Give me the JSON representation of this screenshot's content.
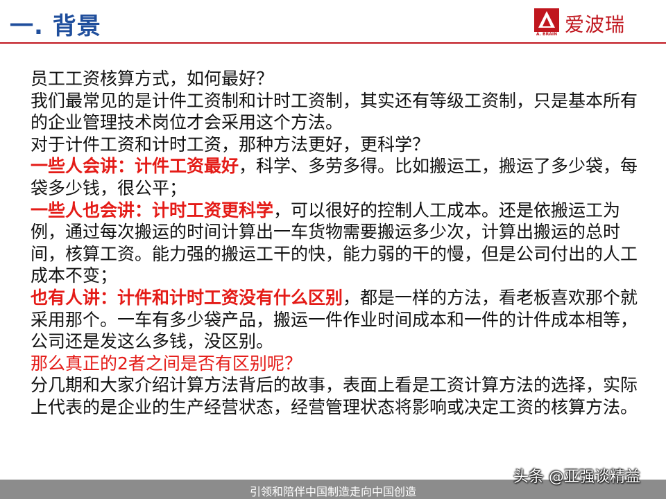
{
  "header": {
    "title": "一. 背景",
    "logo_text": "爱波瑞",
    "logo_sub": "A. BRAIN"
  },
  "body": {
    "p1": "员工工资核算方式，如何最好？",
    "p2": "我们最常见的是计件工资制和计时工资制，其实还有等级工资制，只是基本所有的企业管理技术岗位才会采用这个方法。",
    "p3": "对于计件工资和计时工资，那种方法更好，更科学？",
    "p4_red": "一些人会讲：计件工资最好",
    "p4_rest": "，科学、多劳多得。比如搬运工，搬运了多少袋，每袋多少钱，很公平；",
    "p5_red": "一些人也会讲：计时工资更科学",
    "p5_rest": "，可以很好的控制人工成本。还是依搬运工为例，通过每次搬运的时间计算出一车货物需要搬运多少次，计算出搬运的总时间，核算工资。能力强的搬运工干的快，能力弱的干的慢，但是公司付出的人工成本不变；",
    "p6_red": "也有人讲：计件和计时工资没有什么区别",
    "p6_rest": "，都是一样的方法，看老板喜欢那个就采用那个。一车有多少袋产品，搬运一件作业时间成本和一件的计件成本相等，公司还是发这么多钱，没区别。",
    "p7_red": "那么真正的2者之间是否有区别呢？",
    "p8": "分几期和大家介绍计算方法背后的故事，表面上看是工资计算方法的选择，实际上代表的是企业的生产经营状态，经营管理状态将影响或决定工资的核算方法。"
  },
  "footer": {
    "slogan": "引领和陪伴中国制造走向中国创造",
    "watermark": "头条 @亚强谈精益"
  },
  "colors": {
    "title_blue": "#1f4e9c",
    "accent_red": "#c0161e",
    "highlight_red": "#e41b17",
    "footer_gray": "#8c8c8c"
  }
}
